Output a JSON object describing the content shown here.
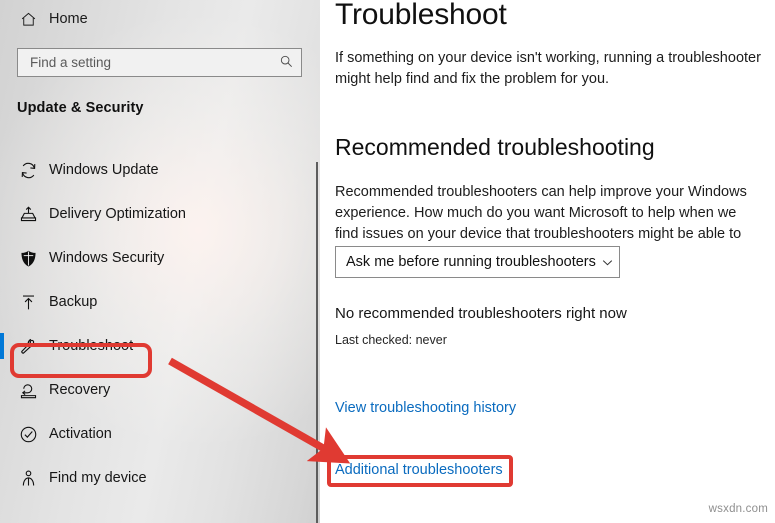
{
  "sidebar": {
    "home": {
      "label": "Home",
      "icon": "home-icon"
    },
    "search": {
      "placeholder": "Find a setting",
      "value": "",
      "icon": "search-icon"
    },
    "section_title": "Update & Security",
    "items": [
      {
        "label": "Windows Update",
        "icon": "sync-icon",
        "selected": false
      },
      {
        "label": "Delivery Optimization",
        "icon": "upload-box-icon",
        "selected": false
      },
      {
        "label": "Windows Security",
        "icon": "shield-icon",
        "selected": false
      },
      {
        "label": "Backup",
        "icon": "upload-arrow-icon",
        "selected": false
      },
      {
        "label": "Troubleshoot",
        "icon": "wrench-icon",
        "selected": true
      },
      {
        "label": "Recovery",
        "icon": "recovery-icon",
        "selected": false
      },
      {
        "label": "Activation",
        "icon": "check-circle-icon",
        "selected": false
      },
      {
        "label": "Find my device",
        "icon": "person-pin-icon",
        "selected": false
      }
    ]
  },
  "main": {
    "title": "Troubleshoot",
    "description": "If something on your device isn't working, running a troubleshooter might help find and fix the problem for you.",
    "section": {
      "heading": "Recommended troubleshooting",
      "description": "Recommended troubleshooters can help improve your Windows experience. How much do you want Microsoft to help when we find issues on your device that troubleshooters might be able to fix?",
      "dropdown": {
        "selected": "Ask me before running troubleshooters",
        "icon": "chevron-down-icon"
      },
      "status": "No recommended troubleshooters right now",
      "last_checked": "Last checked: never"
    },
    "links": [
      {
        "label": "View troubleshooting history",
        "highlighted": false
      },
      {
        "label": "Additional troubleshooters",
        "highlighted": true
      }
    ]
  },
  "annotations": {
    "highlight_color": "#e03a32",
    "arrow": {
      "from_label": "Troubleshoot",
      "to_label": "Additional troubleshooters"
    }
  },
  "watermark": "wsxdn.com",
  "colors": {
    "accent": "#0078d7",
    "link": "#0a6bbf",
    "annotation": "#e03a32"
  }
}
